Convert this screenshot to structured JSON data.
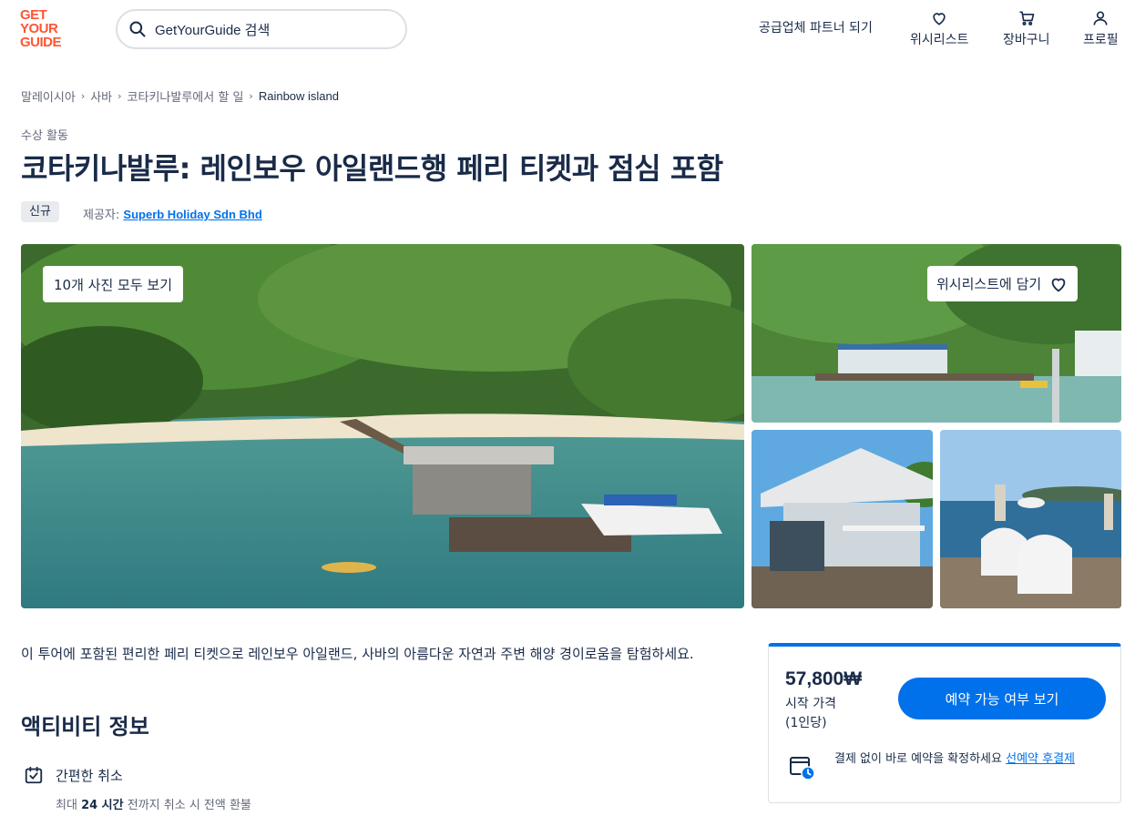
{
  "header": {
    "logo_lines": [
      "GET",
      "YOUR",
      "GUIDE"
    ],
    "search_placeholder": "GetYourGuide 검색",
    "partner_link": "공급업체 파트너 되기",
    "wishlist": "위시리스트",
    "cart": "장바구니",
    "profile": "프로필"
  },
  "breadcrumb": [
    "말레이시아",
    "사바",
    "코타키나발루에서 할 일",
    "Rainbow island"
  ],
  "category": "수상 활동",
  "title": "코타키나발루: 레인보우 아일랜드행 페리 티켓과 점심 포함",
  "badge": "신규",
  "provider": {
    "label": "제공자:",
    "name": "Superb Holiday Sdn Bhd"
  },
  "gallery": {
    "see_all_photos": "10개 사진 모두 보기",
    "add_to_wishlist": "위시리스트에 담기"
  },
  "description": "이 투어에 포함된 편리한 페리 티켓으로 레인보우 아일랜드, 사바의 아름다운 자연과 주변 해양 경이로움을 탐험하세요.",
  "activity_info": {
    "title": "액티비티 정보",
    "features": [
      {
        "icon": "calendar-check-icon",
        "title": "간편한 취소",
        "subtitle_prefix": "최대",
        "subtitle_bold": "24 시간",
        "subtitle_suffix": "전까지 취소 시 전액 환불"
      }
    ]
  },
  "booking": {
    "price": "57,800₩",
    "price_label": "시작 가격",
    "per_person": "(1인당)",
    "check_availability": "예약 가능 여부 보기",
    "note_text": "결제 없이 바로 예약을 확정하세요",
    "note_link": "선예약 후결제"
  },
  "colors": {
    "brand": "#ff5533",
    "primary": "#0071eb",
    "text": "#1a2b49",
    "muted": "#63687a"
  }
}
